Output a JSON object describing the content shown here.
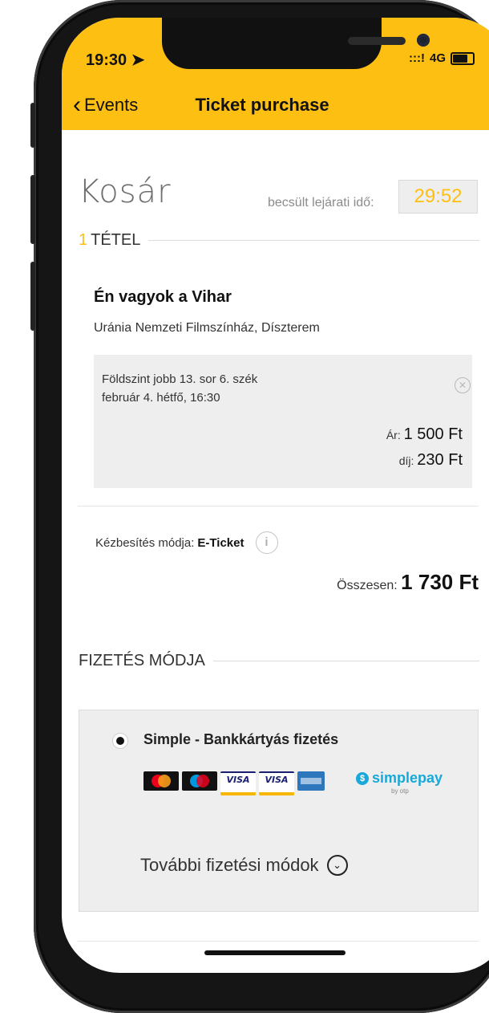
{
  "status": {
    "time": "19:30",
    "signal": ":::!",
    "network": "4G"
  },
  "nav": {
    "back_label": "Events",
    "title": "Ticket purchase"
  },
  "cart": {
    "title": "Kosár",
    "expiry_label": "becsült lejárati idő:",
    "expiry_time": "29:52"
  },
  "items_section": {
    "count": "1",
    "label": "TÉTEL"
  },
  "event": {
    "title": "Én vagyok a Vihar",
    "venue": "Uránia Nemzeti Filmszínház, Díszterem",
    "seat": "Földszint jobb 13. sor 6. szék",
    "datetime": "február 4. hétfő, 16:30",
    "price_label": "Ár:",
    "price_value": "1 500 Ft",
    "fee_label": "díj:",
    "fee_value": "230 Ft"
  },
  "delivery": {
    "label": "Kézbesítés módja:",
    "value": "E-Ticket"
  },
  "total": {
    "label": "Összesen:",
    "value": "1 730 Ft"
  },
  "payment": {
    "section_label": "FIZETÉS MÓDJA",
    "selected_method": "Simple - Bankkártyás fizetés",
    "card_logos": [
      "mastercard",
      "maestro",
      "VISA",
      "VISA",
      "amex"
    ],
    "provider": "simplepay",
    "provider_sub": "by otp",
    "more_label": "További fizetési módok"
  },
  "colors": {
    "accent": "#fdbf12",
    "background": "#ffffff",
    "panel": "#eeeeee"
  }
}
